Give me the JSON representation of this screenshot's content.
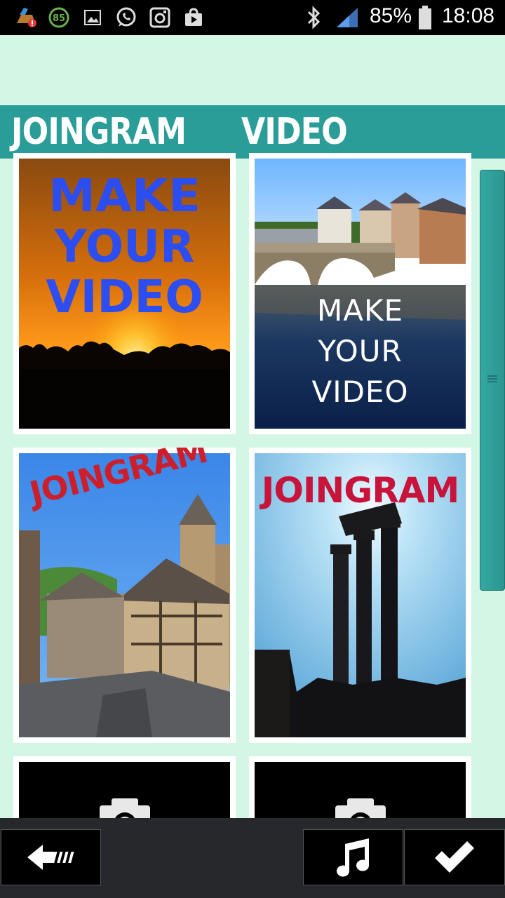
{
  "status_bar": {
    "badge_number": "85",
    "battery_percent": "85%",
    "time": "18:08",
    "icons": [
      "cleaner-icon",
      "battery-saver-icon",
      "gallery-icon",
      "whatsapp-icon",
      "instagram-icon",
      "play-store-icon",
      "bluetooth-icon",
      "signal-icon",
      "battery-icon"
    ]
  },
  "header": {
    "title_left": "JOINGRAM",
    "title_right": "VIDEO"
  },
  "tiles": [
    {
      "name": "sunset",
      "overlay_lines": [
        "MAKE",
        "YOUR",
        "VIDEO"
      ],
      "overlay_color": "#2c4ef0"
    },
    {
      "name": "river-town",
      "overlay_lines": [
        "MAKE",
        "YOUR",
        "VIDEO"
      ],
      "overlay_color": "#ffffff"
    },
    {
      "name": "village",
      "overlay_lines": [
        "JOINGRAM"
      ],
      "overlay_color": "#cc1f2b"
    },
    {
      "name": "columns",
      "overlay_lines": [
        "JOINGRAM"
      ],
      "overlay_color": "#c8133a"
    },
    {
      "name": "empty-slot-1",
      "icon": "camera-icon"
    },
    {
      "name": "empty-slot-2",
      "icon": "camera-icon"
    }
  ],
  "bottom_bar": {
    "back_icon": "back-arrow-icon",
    "music_icon": "music-note-icon",
    "confirm_icon": "checkmark-icon"
  },
  "colors": {
    "background": "#d4f6e4",
    "header": "#2a9d98",
    "bottom_bar": "#26282b"
  }
}
